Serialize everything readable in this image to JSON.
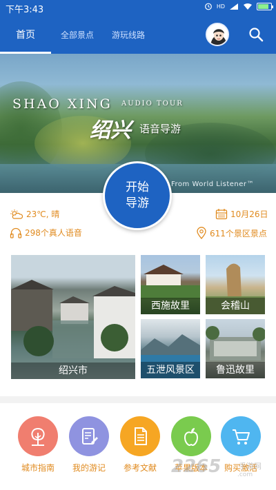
{
  "statusbar": {
    "time": "下午3:43",
    "hd": "HD",
    "battery_level": 0.85,
    "battery_color": "#8ef08e"
  },
  "header": {
    "tabs": [
      {
        "label": "首页",
        "active": true
      },
      {
        "label": "全部景点",
        "active": false
      },
      {
        "label": "游玩线路",
        "active": false
      }
    ],
    "search_icon": "search-icon",
    "avatar_icon": "avatar"
  },
  "banner": {
    "en_title": "SHAO XING",
    "en_sub": "AUDIO TOUR",
    "cn_big": "绍兴",
    "cn_small": "语音导游",
    "from": "From World Listener™"
  },
  "start_button": {
    "line1": "开始",
    "line2": "导游"
  },
  "info": {
    "weather": "23℃, 晴",
    "date": "10月26日",
    "voices": "298个真人语音",
    "spots": "611个景区景点"
  },
  "tiles": [
    {
      "label": "绍兴市"
    },
    {
      "label": "西施故里"
    },
    {
      "label": "会稽山"
    },
    {
      "label": "五泄风景区"
    },
    {
      "label": "鲁迅故里"
    }
  ],
  "bottom_nav": [
    {
      "label": "城市指南",
      "color": "#f07e6f",
      "icon": "city-guide-icon"
    },
    {
      "label": "我的游记",
      "color": "#8f93e0",
      "icon": "travel-notes-icon"
    },
    {
      "label": "参考文献",
      "color": "#f6a623",
      "icon": "document-icon"
    },
    {
      "label": "苹果版本",
      "color": "#7acb4e",
      "icon": "apple-icon"
    },
    {
      "label": "购买激活",
      "color": "#4fb6f0",
      "icon": "cart-icon"
    }
  ],
  "watermark": {
    "brand": "2265",
    "small": "手游网",
    "url": ".com"
  },
  "colors": {
    "primary": "#1e63c2",
    "accent": "#e08a1e"
  }
}
